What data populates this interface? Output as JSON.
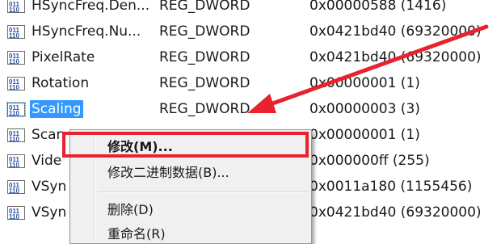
{
  "registry_values": [
    {
      "name": "HSyncFreq.Den...",
      "type": "REG_DWORD",
      "data": "0x00000588 (1416)",
      "selected": false
    },
    {
      "name": "HSyncFreq.Nu...",
      "type": "REG_DWORD",
      "data": "0x0421bd40 (69320000)",
      "selected": false
    },
    {
      "name": "PixelRate",
      "type": "REG_DWORD",
      "data": "0x0421bd40 (69320000)",
      "selected": false
    },
    {
      "name": "Rotation",
      "type": "REG_DWORD",
      "data": "0x00000001 (1)",
      "selected": false
    },
    {
      "name": "Scaling",
      "type": "REG_DWORD",
      "data": "0x00000003 (3)",
      "selected": true
    },
    {
      "name": "Scan",
      "type": "",
      "data": "0x00000001 (1)",
      "selected": false
    },
    {
      "name": "Vide",
      "type": "",
      "data": "0x000000ff (255)",
      "selected": false
    },
    {
      "name": "VSyn",
      "type": "",
      "data": "0x0011a180 (1155456)",
      "selected": false
    },
    {
      "name": "VSyn",
      "type": "",
      "data": "0x0421bd40 (69320000)",
      "selected": false
    }
  ],
  "context_menu": {
    "modify": "修改(M)...",
    "modify_binary": "修改二进制数据(B)...",
    "delete": "删除(D)",
    "rename": "重命名(R)"
  },
  "annotation": {
    "highlight_color": "#e8232f"
  },
  "icons": {
    "value_icon": "reg-dword-value-icon"
  }
}
